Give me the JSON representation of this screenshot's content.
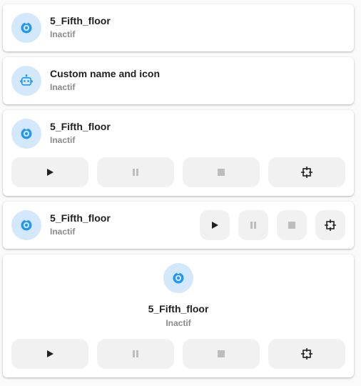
{
  "cards": [
    {
      "name": "5_Fifth_floor",
      "state": "Inactif",
      "icon": "robot-vacuum-icon"
    },
    {
      "name": "Custom name and icon",
      "state": "Inactif",
      "icon": "robot-icon"
    },
    {
      "name": "5_Fifth_floor",
      "state": "Inactif",
      "icon": "robot-vacuum-icon"
    },
    {
      "name": "5_Fifth_floor",
      "state": "Inactif",
      "icon": "robot-vacuum-icon"
    },
    {
      "name": "5_Fifth_floor",
      "state": "Inactif",
      "icon": "robot-vacuum-icon"
    }
  ],
  "controls": {
    "start_icon": "play-icon",
    "pause_icon": "pause-icon",
    "stop_icon": "stop-icon",
    "locate_icon": "crosshair-icon"
  },
  "colors": {
    "accent": "#2196f3",
    "icon_bg": "#d3e8fb",
    "button_bg": "#f1f1f1",
    "disabled": "#bdbdbd"
  }
}
